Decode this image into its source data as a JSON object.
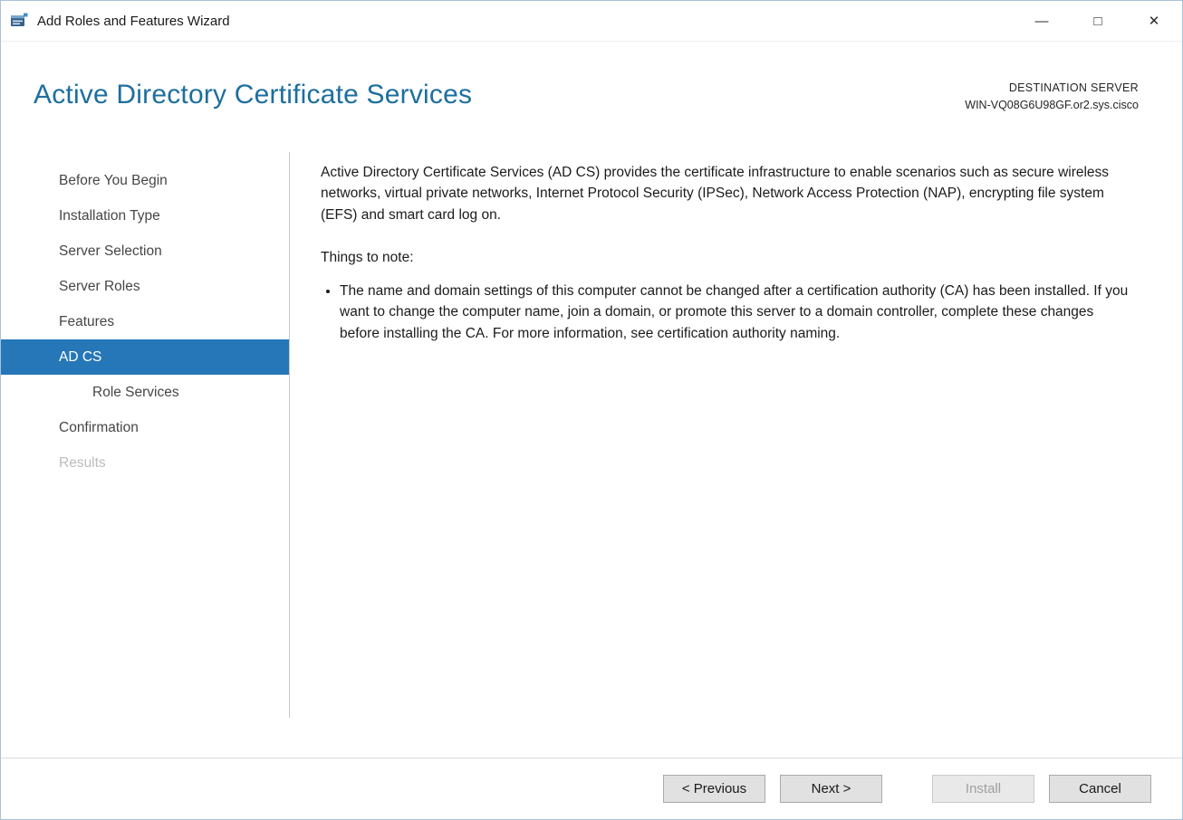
{
  "window": {
    "title": "Add Roles and Features Wizard",
    "controls": {
      "minimize_glyph": "—",
      "maximize_glyph": "□",
      "close_glyph": "✕"
    }
  },
  "header": {
    "title": "Active Directory Certificate Services",
    "destination_label": "DESTINATION SERVER",
    "destination_server": "WIN-VQ08G6U98GF.or2.sys.cisco"
  },
  "sidebar": {
    "items": [
      {
        "label": "Before You Begin",
        "state": "normal"
      },
      {
        "label": "Installation Type",
        "state": "normal"
      },
      {
        "label": "Server Selection",
        "state": "normal"
      },
      {
        "label": "Server Roles",
        "state": "normal"
      },
      {
        "label": "Features",
        "state": "normal"
      },
      {
        "label": "AD CS",
        "state": "selected"
      },
      {
        "label": "Role Services",
        "state": "child"
      },
      {
        "label": "Confirmation",
        "state": "normal"
      },
      {
        "label": "Results",
        "state": "disabled"
      }
    ]
  },
  "content": {
    "intro": "Active Directory Certificate Services (AD CS) provides the certificate infrastructure to enable scenarios such as secure wireless networks, virtual private networks, Internet Protocol Security (IPSec), Network Access Protection (NAP), encrypting file system (EFS) and smart card log on.",
    "note_heading": "Things to note:",
    "bullets": [
      "The name and domain settings of this computer cannot be changed after a certification authority (CA) has been installed. If you want to change the computer name, join a domain, or promote this server to a domain controller, complete these changes before installing the CA. For more information, see certification authority naming."
    ]
  },
  "footer": {
    "buttons": [
      {
        "label": "< Previous",
        "enabled": true
      },
      {
        "label": "Next >",
        "enabled": true
      },
      {
        "label": "Install",
        "enabled": false
      },
      {
        "label": "Cancel",
        "enabled": true
      }
    ]
  },
  "colors": {
    "title_accent": "#1d6f9e",
    "nav_selected_bg": "#2677b8",
    "nav_selected_text": "#ffffff",
    "button_face": "#e1e1e1",
    "disabled_text": "#9f9f9f"
  }
}
